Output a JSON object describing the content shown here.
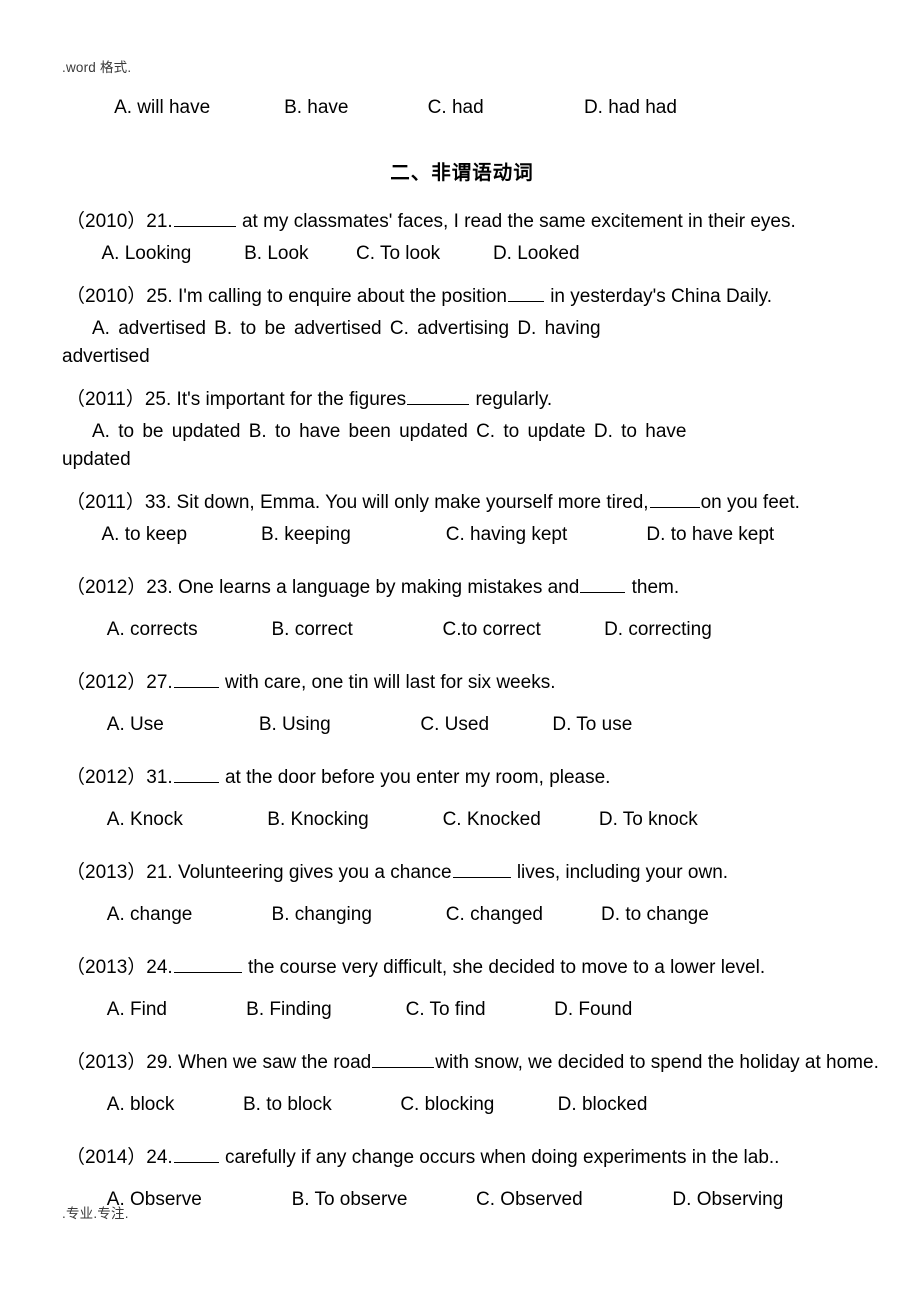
{
  "document": {
    "running_header": ".word 格式.",
    "running_footer": ".专业.专注.",
    "top_answer_line": "    A. will have              B. have               C. had                   D. had had",
    "section_heading": "二、非谓语动词"
  },
  "questions": [
    {
      "id": "q-2010-21",
      "year": "（2010）",
      "number": "21.",
      "stem_before": "（2010）21.",
      "stem_after": "at my classmates' faces, I read the same excitement in their eyes.",
      "blank_width": 62,
      "options_line": "  A. Looking          B. Look         C. To look          D. Looked",
      "options": [
        "A. Looking",
        "B. Look",
        "C. To look",
        "D. Looked"
      ],
      "wrap_line": ""
    },
    {
      "id": "q-2010-25",
      "year": "（2010）",
      "number": "25.",
      "stem_before": "（2010）25. I'm calling to enquire about the position",
      "stem_after": "in yesterday's China Daily.",
      "blank_width": 36,
      "options_line": "  A. advertised                 B. to be advertised               C. advertising                D. having",
      "options": [
        "A. advertised",
        "B. to be advertised",
        "C. advertising",
        "D. having advertised"
      ],
      "wrap_line": "advertised"
    },
    {
      "id": "q-2011-25",
      "year": "（2011）",
      "number": "25.",
      "stem_before": "（2011）25. It's important for the figures",
      "stem_after": "regularly.",
      "blank_width": 62,
      "options_line": "  A. to be updated            B. to have been updated        C. to update     D. to have",
      "options": [
        "A. to be updated",
        "B. to have been updated",
        "C. to update",
        "D. to have updated"
      ],
      "wrap_line": "updated"
    },
    {
      "id": "q-2011-33",
      "year": "（2011）",
      "number": "33.",
      "stem_before": "（2011）33. Sit down, Emma. You will only make yourself more tired,",
      "stem_after": "on you feet.",
      "blank_width": 50,
      "options_line": "  A. to keep              B. keeping                  C. having kept               D. to have kept",
      "options": [
        "A. to keep",
        "B. keeping",
        "C. having kept",
        "D. to have kept"
      ],
      "wrap_line": ""
    },
    {
      "id": "q-2012-23",
      "year": "（2012）",
      "number": "23.",
      "stem_before": "（2012）23. One learns a language by making mistakes and",
      "stem_after": "them.",
      "blank_width": 45,
      "options_line": "   A. corrects              B. correct                 C.to correct            D. correcting",
      "options": [
        "A. corrects",
        "B. correct",
        "C.to correct",
        "D. correcting"
      ],
      "wrap_line": ""
    },
    {
      "id": "q-2012-27",
      "year": "（2012）",
      "number": "27.",
      "stem_before": "（2012）27.",
      "stem_after": "with care, one tin will last for six weeks.",
      "blank_width": 45,
      "options_line": "   A. Use                  B. Using                 C. Used            D. To use",
      "options": [
        "A. Use",
        "B. Using",
        "C. Used",
        "D. To use"
      ],
      "wrap_line": ""
    },
    {
      "id": "q-2012-31",
      "year": "（2012）",
      "number": "31.",
      "stem_before": "（2012）31.",
      "stem_after": "at the door before you enter my room, please.",
      "blank_width": 45,
      "options_line": "   A. Knock                B. Knocking              C. Knocked           D. To knock",
      "options": [
        "A. Knock",
        "B. Knocking",
        "C. Knocked",
        "D. To knock"
      ],
      "wrap_line": ""
    },
    {
      "id": "q-2013-21",
      "year": "（2013）",
      "number": "21.",
      "stem_before": "（2013）21. Volunteering gives you a chance",
      "stem_after": "lives, including your own.",
      "blank_width": 58,
      "options_line": "   A. change               B. changing              C. changed           D. to change",
      "options": [
        "A. change",
        "B. changing",
        "C. changed",
        "D. to change"
      ],
      "wrap_line": ""
    },
    {
      "id": "q-2013-24",
      "year": "（2013）",
      "number": "24.",
      "stem_before": "（2013）24.",
      "stem_after": "the course very difficult, she decided to move to a lower level.",
      "blank_width": 68,
      "options_line": "   A. Find               B. Finding              C. To find             D. Found",
      "options": [
        "A. Find",
        "B. Finding",
        "C. To find",
        "D. Found"
      ],
      "wrap_line": ""
    },
    {
      "id": "q-2013-29",
      "year": "（2013）",
      "number": "29.",
      "stem_before": "（2013）29. When we saw the road",
      "stem_after": "with snow, we decided to spend the holiday at home.",
      "blank_width": 62,
      "options_line": "   A. block             B. to block             C. blocking            D. blocked",
      "options": [
        "A. block",
        "B. to block",
        "C. blocking",
        "D. blocked"
      ],
      "wrap_line": ""
    },
    {
      "id": "q-2014-24",
      "year": "（2014）",
      "number": "24.",
      "stem_before": "（2014）24.",
      "stem_after": "carefully if any change occurs when doing experiments in the lab..",
      "blank_width": 45,
      "options_line": "   A. Observe                 B. To observe             C. Observed                 D. Observing",
      "options": [
        "A. Observe",
        "B. To observe",
        "C. Observed",
        "D. Observing"
      ],
      "wrap_line": ""
    }
  ]
}
